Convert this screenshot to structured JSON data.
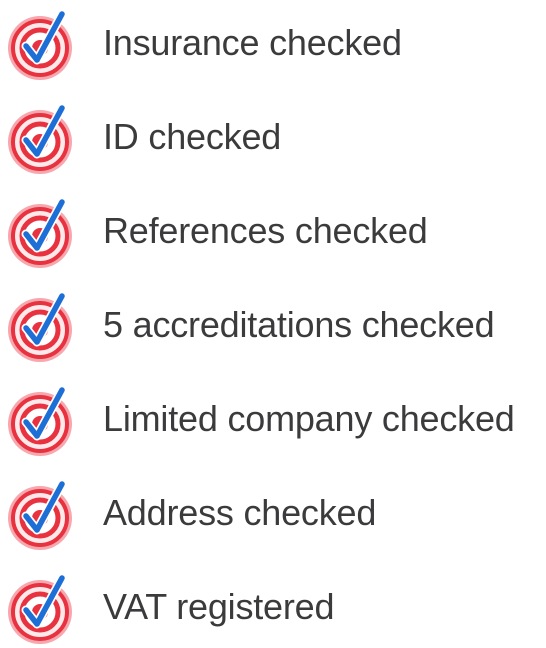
{
  "accent": {
    "ring": "#e8323f",
    "ring_light": "#f6a8ae",
    "checkmark": "#1d6fd6"
  },
  "checks": [
    {
      "label": "Insurance checked",
      "icon": "check-badge-icon"
    },
    {
      "label": "ID checked",
      "icon": "check-badge-icon"
    },
    {
      "label": "References checked",
      "icon": "check-badge-icon"
    },
    {
      "label": "5 accreditations checked",
      "icon": "check-badge-icon"
    },
    {
      "label": "Limited company checked",
      "icon": "check-badge-icon"
    },
    {
      "label": "Address checked",
      "icon": "check-badge-icon"
    },
    {
      "label": "VAT registered",
      "icon": "check-badge-icon"
    }
  ]
}
